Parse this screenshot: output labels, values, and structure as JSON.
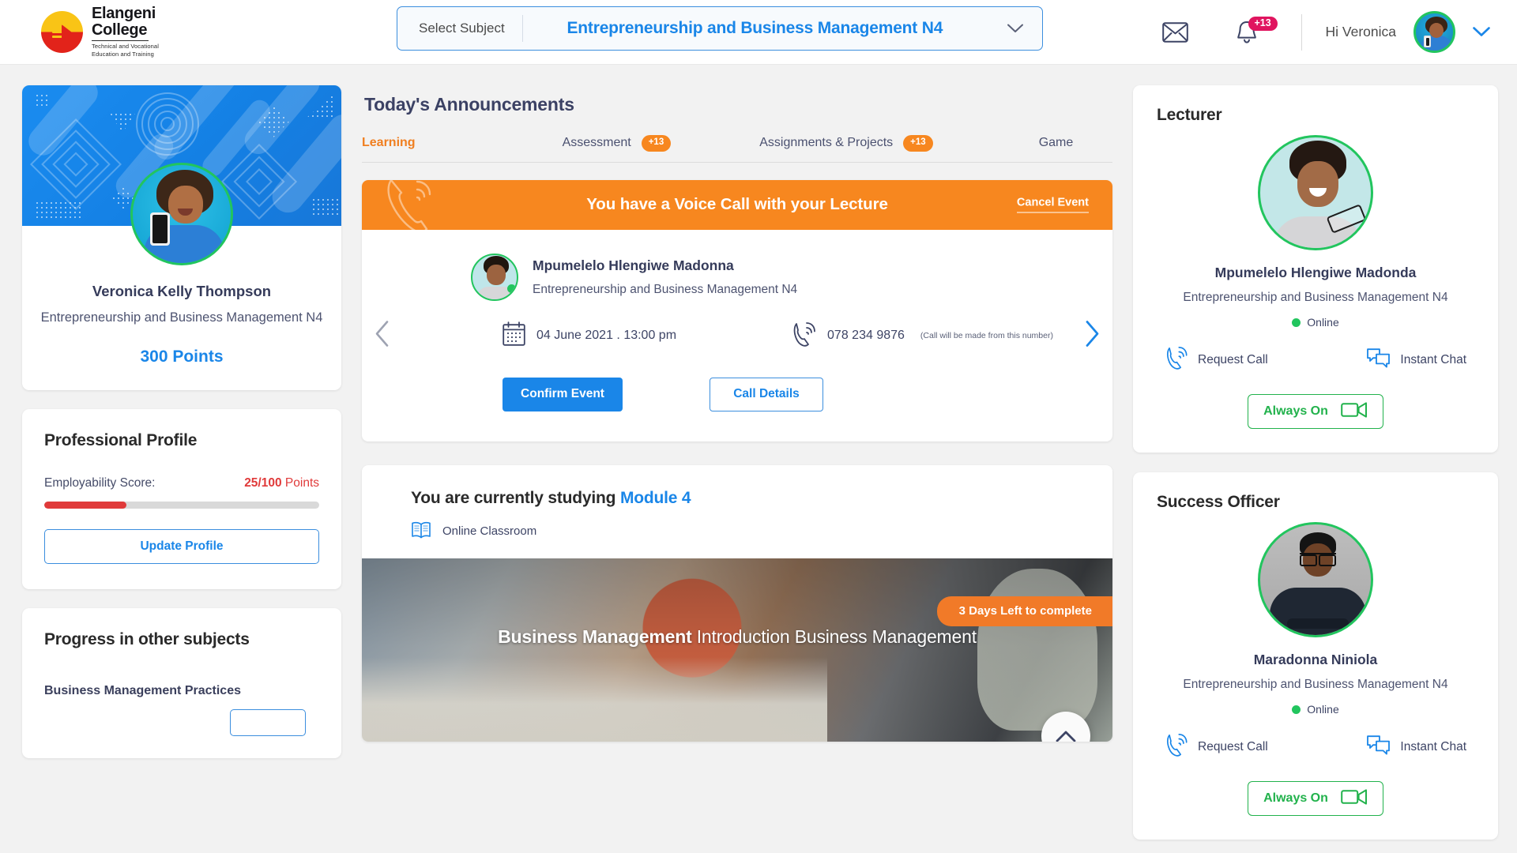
{
  "header": {
    "logo": {
      "line1": "Elangeni",
      "line2": "College",
      "tagline": "Technical and Vocational\nEducation and Training"
    },
    "subject_selector": {
      "label": "Select Subject",
      "value": "Entrepreneurship and Business Management N4"
    },
    "mail_icon": "envelope-icon",
    "bell_icon": "bell-icon",
    "notification_badge": "+13",
    "greeting": "Hi Veronica"
  },
  "profile": {
    "name": "Veronica Kelly Thompson",
    "subject": "Entrepreneurship and Business Management N4",
    "points": "300 Points"
  },
  "professional_profile": {
    "title": "Professional Profile",
    "score_label": "Employability Score:",
    "score_value": "25/100",
    "score_unit": " Points",
    "progress_percent": 30,
    "update_button": "Update Profile"
  },
  "other_subjects": {
    "title": "Progress in other subjects",
    "first_subject": "Business Management Practices"
  },
  "announcements": {
    "title": "Today's Announcements",
    "tabs": [
      {
        "label": "Learning",
        "badge": "",
        "active": true
      },
      {
        "label": "Assessment",
        "badge": "+13",
        "active": false
      },
      {
        "label": "Assignments & Projects",
        "badge": "+13",
        "active": false
      },
      {
        "label": "Game",
        "badge": "",
        "active": false
      }
    ]
  },
  "event": {
    "banner_text": "You have a Voice Call with your Lecture",
    "cancel_label": "Cancel Event",
    "person_name": "Mpumelelo Hlengiwe Madonna",
    "person_subject": "Entrepreneurship and Business Management N4",
    "datetime": "04 June 2021 .  13:00 pm",
    "phone": "078 234 9876",
    "phone_note": "(Call will be made from this number)",
    "confirm_button": "Confirm Event",
    "details_button": "Call Details",
    "prev_icon": "chevron-left-icon",
    "next_icon": "chevron-right-icon",
    "calendar_icon": "calendar-icon",
    "phone_icon": "phone-call-icon"
  },
  "study": {
    "heading_prefix": "You are currently studying ",
    "module": "Module 4",
    "classroom_label": "Online Classroom",
    "classroom_icon": "open-book-icon",
    "hero_title_bold": "Business Management",
    "hero_title_rest": " Introduction Business Management",
    "days_badge": "3 Days Left to complete",
    "scroll_top_icon": "chevron-up-icon"
  },
  "lecturer": {
    "title": "Lecturer",
    "name": "Mpumelelo Hlengiwe Madonda",
    "subject": "Entrepreneurship and Business Management N4",
    "status": "Online",
    "request_call": "Request Call",
    "instant_chat": "Instant Chat",
    "always_on": "Always On"
  },
  "success_officer": {
    "title": "Success Officer",
    "name": "Maradonna Niniola",
    "subject": "Entrepreneurship and Business Management N4",
    "status": "Online",
    "request_call": "Request Call",
    "instant_chat": "Instant Chat",
    "always_on": "Always On"
  },
  "colors": {
    "brand_blue": "#1a86e8",
    "accent_orange": "#f7871f",
    "danger_red": "#e03a3a",
    "online_green": "#22c55e",
    "badge_pink": "#e0155f"
  }
}
